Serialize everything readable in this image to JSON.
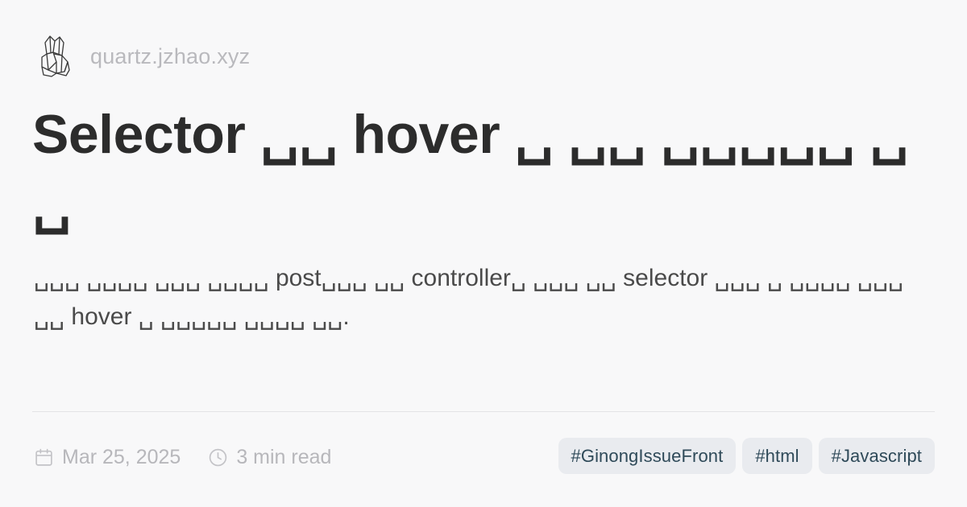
{
  "site": {
    "logo_icon": "crystal-cluster-icon",
    "name": "quartz.jzhao.xyz"
  },
  "article": {
    "title": "Selector ␣␣ hover ␣ ␣␣ ␣␣␣␣␣ ␣ ␣",
    "description": "␣␣␣ ␣␣␣␣ ␣␣␣ ␣␣␣␣ post␣␣␣ ␣␣ controller␣ ␣␣␣ ␣␣ selector ␣␣␣ ␣ ␣␣␣␣ ␣␣␣ ␣␣ hover ␣ ␣␣␣␣␣ ␣␣␣␣ ␣␣."
  },
  "meta": {
    "date_icon": "calendar-icon",
    "date": "Mar 25, 2025",
    "read_icon": "clock-icon",
    "reading_time": "3 min read"
  },
  "tags": [
    "#GinongIssueFront",
    "#html",
    "#Javascript"
  ]
}
